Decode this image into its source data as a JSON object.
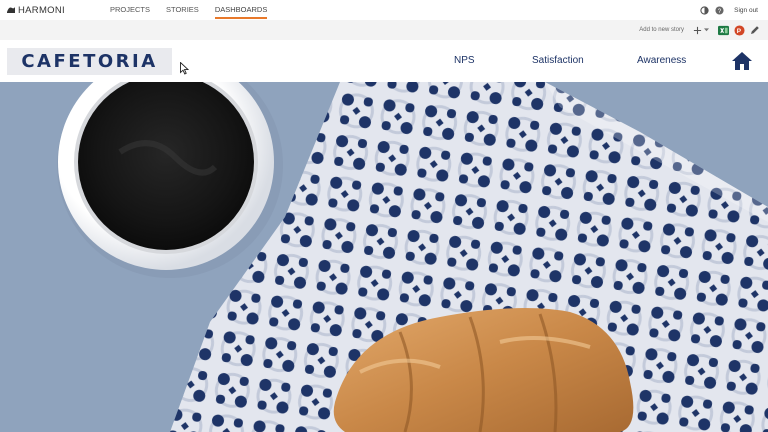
{
  "appbar": {
    "brand": "HARMONI",
    "nav": [
      {
        "label": "PROJECTS",
        "active": false
      },
      {
        "label": "STORIES",
        "active": false
      },
      {
        "label": "DASHBOARDS",
        "active": true
      }
    ],
    "signout": "Sign out",
    "icons": [
      "contrast-icon",
      "help-icon"
    ]
  },
  "toolbar": {
    "add_label": "Add to new story",
    "add_icon": "plus-icon",
    "export_icons": [
      "excel-icon",
      "powerpoint-icon",
      "pencil-icon"
    ]
  },
  "dashboard": {
    "logo": "CAFETORIA",
    "nav": [
      {
        "label": "NPS"
      },
      {
        "label": "Satisfaction"
      },
      {
        "label": "Awareness"
      }
    ],
    "home_icon": "home-icon"
  },
  "colors": {
    "navy": "#1d3366",
    "accent": "#e8792b",
    "hero_bg": "#8fa3bd",
    "excel": "#1e7a44",
    "powerpoint": "#d24726"
  }
}
